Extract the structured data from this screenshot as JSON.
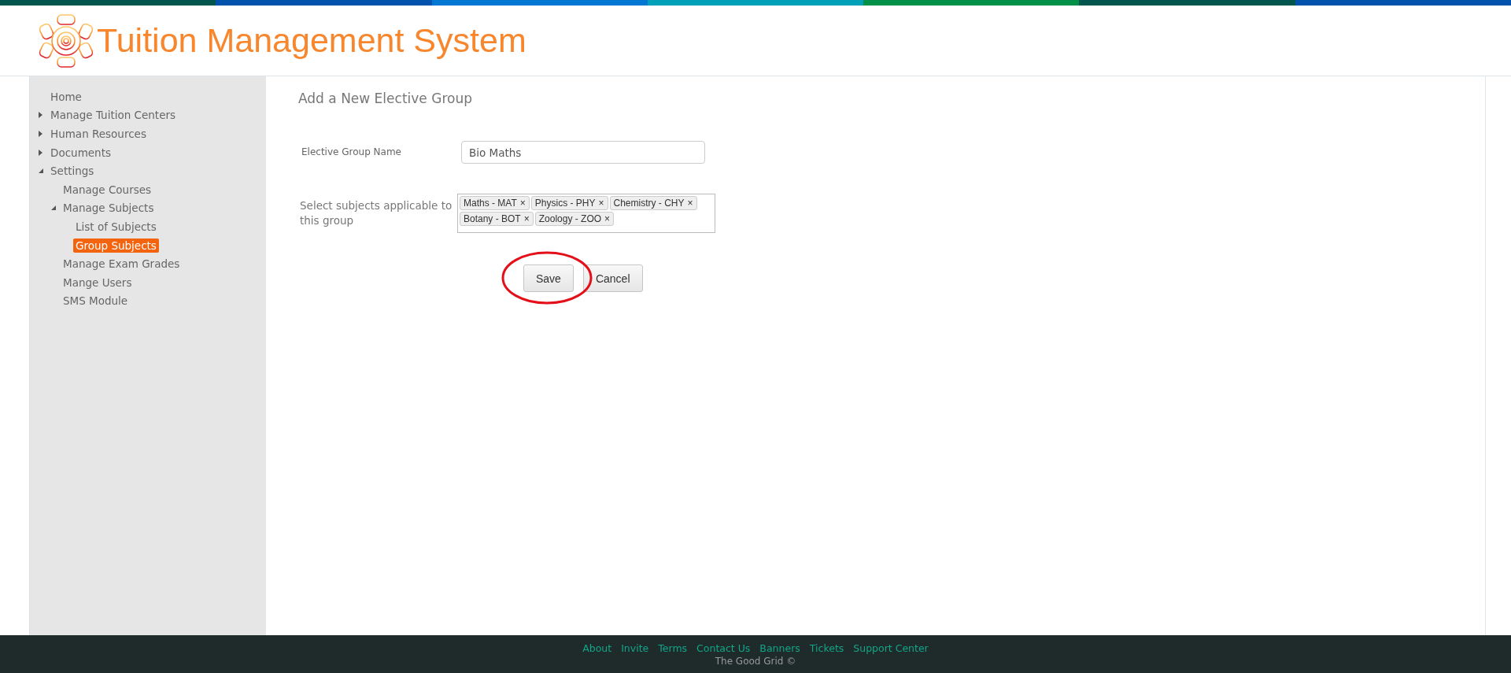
{
  "header": {
    "title": "Tuition Management System"
  },
  "sidebar": {
    "items": [
      {
        "label": "Home",
        "selected": false
      },
      {
        "label": "Manage Tuition Centers",
        "expanded": false,
        "selected": false
      },
      {
        "label": "Human Resources",
        "expanded": false,
        "selected": false
      },
      {
        "label": "Documents",
        "expanded": false,
        "selected": false
      },
      {
        "label": "Settings",
        "expanded": true,
        "selected": false,
        "children": [
          {
            "label": "Manage Courses",
            "selected": false
          },
          {
            "label": "Manage Subjects",
            "expanded": true,
            "selected": false,
            "children": [
              {
                "label": "List of Subjects",
                "selected": false
              },
              {
                "label": "Group Subjects",
                "selected": true
              }
            ]
          },
          {
            "label": "Manage Exam Grades",
            "selected": false
          },
          {
            "label": "Mange Users",
            "selected": false
          },
          {
            "label": "SMS Module",
            "selected": false
          }
        ]
      }
    ]
  },
  "form": {
    "title": "Add a New Elective Group",
    "name_label": "Elective Group  Name",
    "name_value": "Bio Maths",
    "subjects_label": "Select subjects applicable to this group",
    "subjects": [
      {
        "label": "Maths - MAT",
        "remove": "×"
      },
      {
        "label": "Physics - PHY",
        "remove": "×"
      },
      {
        "label": "Chemistry - CHY",
        "remove": "×"
      },
      {
        "label": "Botany - BOT",
        "remove": "×"
      },
      {
        "label": "Zoology - ZOO",
        "remove": "×"
      }
    ],
    "buttons": [
      "Save",
      "Cancel"
    ]
  },
  "footer": {
    "links": [
      "About",
      "Invite",
      "Terms",
      "Contact Us",
      "Banners",
      "Tickets",
      "Support Center"
    ],
    "copyright": "The Good Grid ©"
  }
}
